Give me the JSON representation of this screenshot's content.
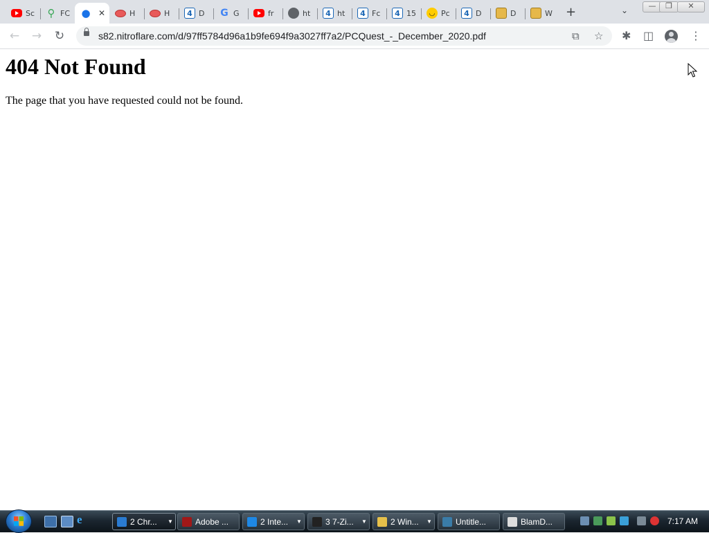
{
  "browser": {
    "tabs": [
      {
        "title": "Sc",
        "icon": "youtube-icon"
      },
      {
        "title": "FC",
        "icon": "search-icon"
      },
      {
        "title": "",
        "icon": "drop-icon",
        "active": true
      },
      {
        "title": "H",
        "icon": "oval-icon"
      },
      {
        "title": "H",
        "icon": "oval-icon"
      },
      {
        "title": "D",
        "icon": "four-icon"
      },
      {
        "title": "G",
        "icon": "google-icon"
      },
      {
        "title": "fr",
        "icon": "youtube-icon"
      },
      {
        "title": "ht",
        "icon": "globe-icon"
      },
      {
        "title": "ht",
        "icon": "four-icon"
      },
      {
        "title": "Fc",
        "icon": "four-icon"
      },
      {
        "title": "15",
        "icon": "four-icon"
      },
      {
        "title": "Pc",
        "icon": "smile-icon"
      },
      {
        "title": "D",
        "icon": "four-icon"
      },
      {
        "title": "D",
        "icon": "folder-icon"
      },
      {
        "title": "W",
        "icon": "folder-icon"
      }
    ],
    "url": "s82.nitroflare.com/d/97ff5784d96a1b9fe694f9a3027ff7a2/PCQuest_-_December_2020.pdf"
  },
  "page": {
    "heading": "404 Not Found",
    "message": "The page that you have requested could not be found."
  },
  "taskbar": {
    "buttons": [
      {
        "label": "2 Chr...",
        "icon": "chrome-icon",
        "color": "#2a7bd1",
        "active": true,
        "arrow": true
      },
      {
        "label": "Adobe ...",
        "icon": "flash-icon",
        "color": "#a01818",
        "arrow": false
      },
      {
        "label": "2 Inte...",
        "icon": "ie-icon",
        "color": "#1e88e5",
        "arrow": true
      },
      {
        "label": "3 7-Zi...",
        "icon": "7zip-icon",
        "color": "#222222",
        "arrow": true
      },
      {
        "label": "2 Win...",
        "icon": "folder-icon",
        "color": "#e6c04a",
        "arrow": true
      },
      {
        "label": "Untitle...",
        "icon": "app-icon",
        "color": "#3a7ca8",
        "arrow": false
      },
      {
        "label": "BlamD...",
        "icon": "document-icon",
        "color": "#dddddd",
        "arrow": false
      }
    ],
    "clock": "7:17 AM"
  }
}
